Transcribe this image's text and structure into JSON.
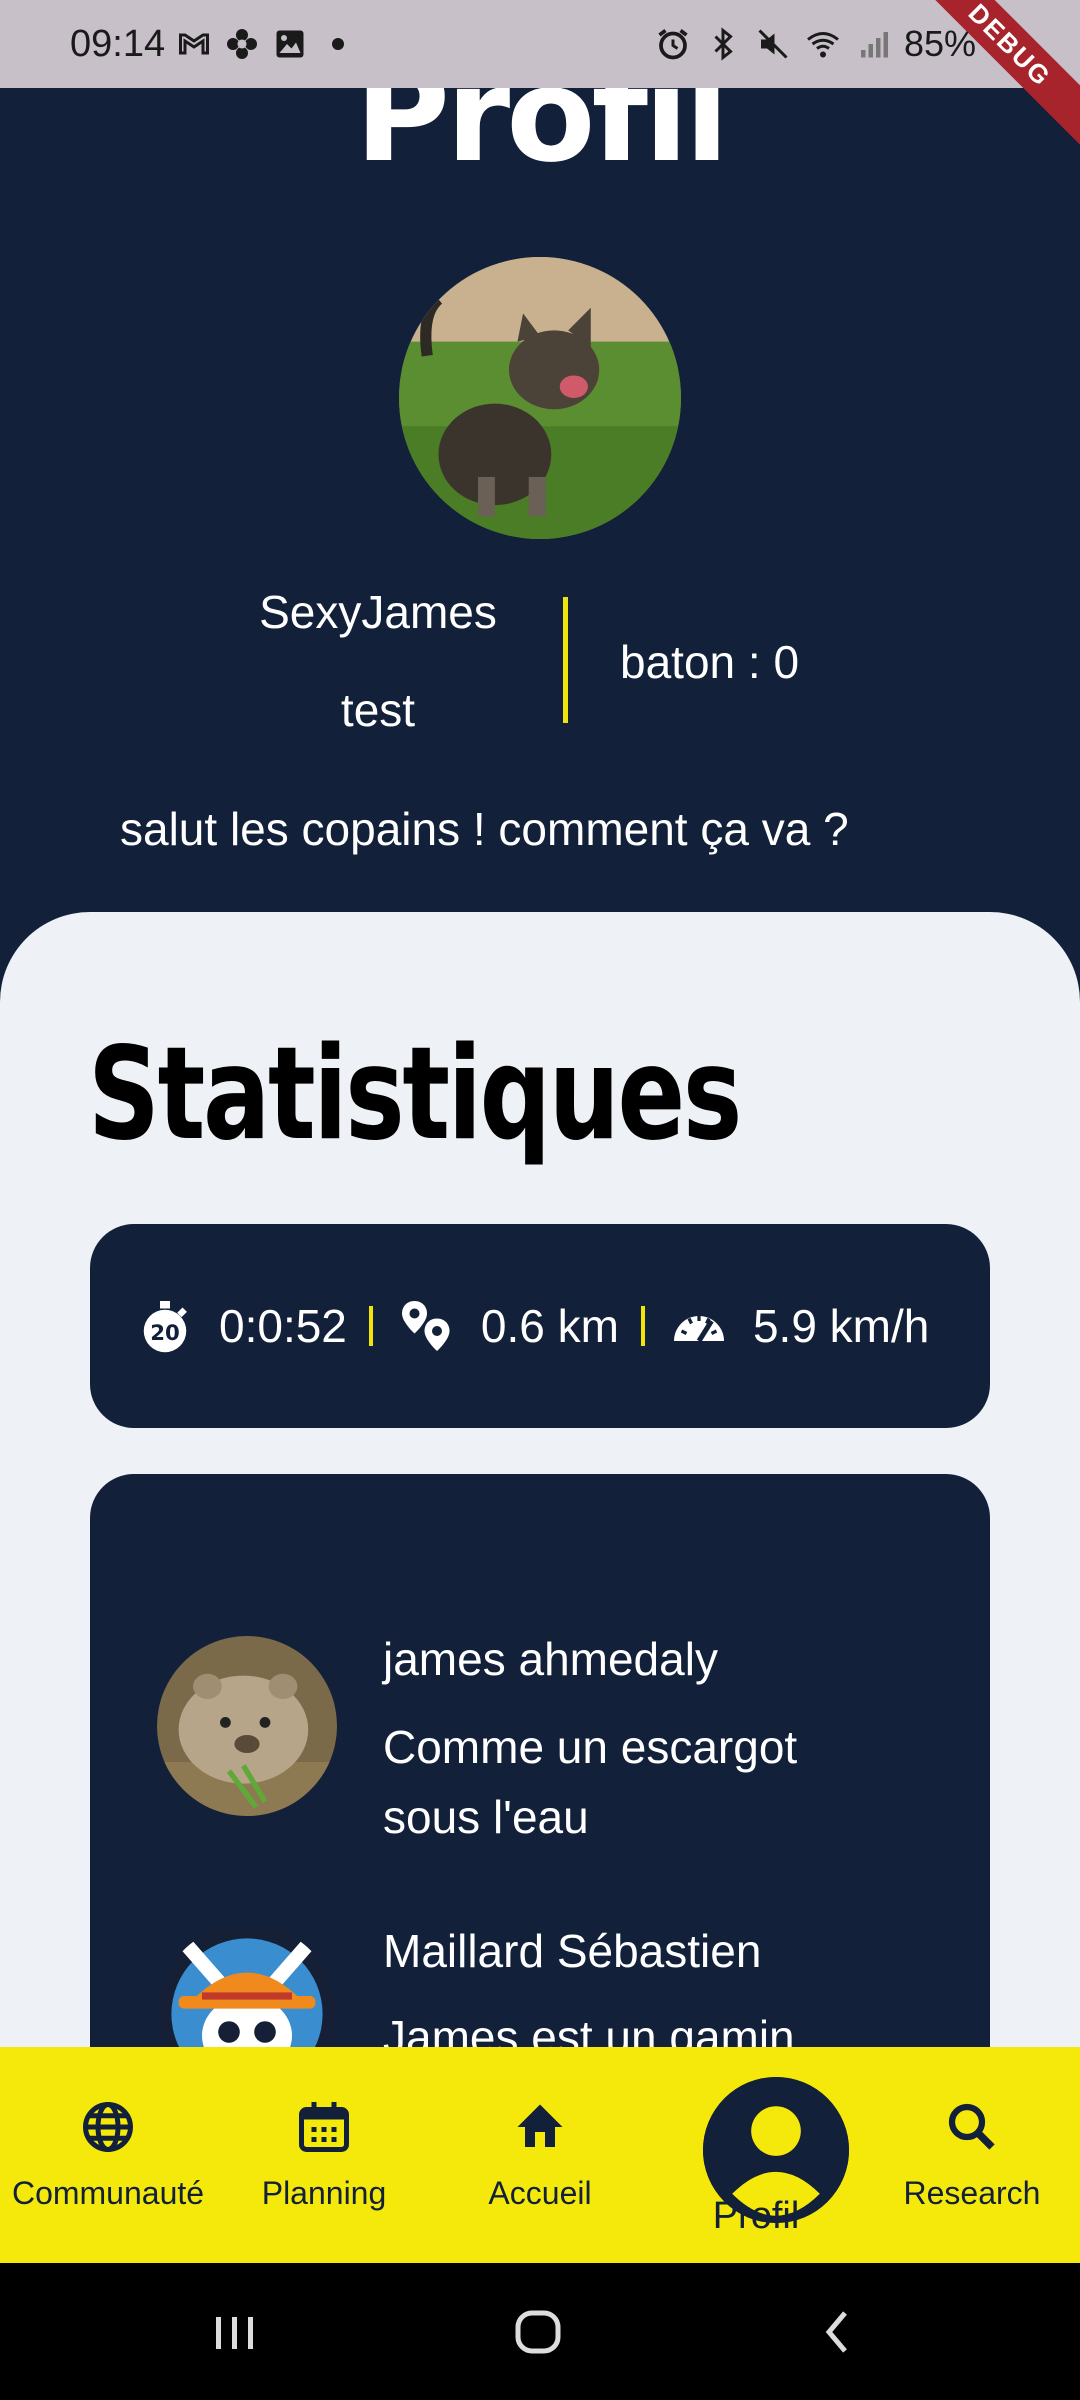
{
  "status_bar": {
    "time": "09:14",
    "battery": "85%",
    "debug_banner": "DEBUG"
  },
  "profile": {
    "title": "Profil",
    "username": "SexyJames",
    "subtitle": "test",
    "baton": "baton : 0",
    "bio": "salut les copains ! comment ça va ?"
  },
  "stats": {
    "title": "Statistiques",
    "duration": "0:0:52",
    "distance": "0.6 km",
    "speed": "5.9 km/h"
  },
  "feed": [
    {
      "name": "james ahmedaly",
      "message": "Comme un escargot sous l'eau"
    },
    {
      "name": "Maillard Sébastien",
      "message": "James est un gamin"
    }
  ],
  "bottom_nav": {
    "items": [
      {
        "label": "Communauté",
        "icon": "globe-icon"
      },
      {
        "label": "Planning",
        "icon": "calendar-icon"
      },
      {
        "label": "Accueil",
        "icon": "home-icon"
      },
      {
        "label": "Profil",
        "icon": "account-icon",
        "active": true
      },
      {
        "label": "Research",
        "icon": "search-icon"
      }
    ]
  },
  "colors": {
    "navy": "#12203a",
    "accent_yellow": "#f5e90b",
    "panel_bg": "#eef1f6"
  }
}
